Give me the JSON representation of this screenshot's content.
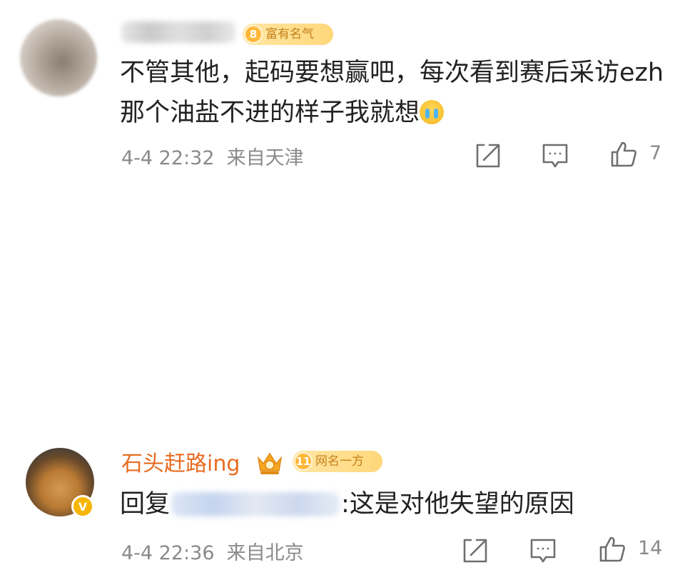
{
  "comments": [
    {
      "avatar": "blurred-avatar",
      "badge": {
        "level": "8",
        "label": "富有名气"
      },
      "content": "不管其他，起码要想赢吧，每次看到赛后采访ezh那个油盐不进的样子我就想",
      "emoji": "crying-face-emoji",
      "timestamp": "4-4 22:32",
      "location": "来自天津",
      "likes": "7"
    },
    {
      "avatar": "shiba-dog-avatar",
      "username": "石头赶路ing",
      "verified_mark": "V",
      "badge": {
        "level": "11",
        "label": "网名一方"
      },
      "reply_prefix": "回复",
      "content": ":这是对他失望的原因",
      "timestamp": "4-4 22:36",
      "location": "来自北京",
      "likes": "14"
    }
  ],
  "colors": {
    "username": "#e86b1f",
    "badge_text": "#c5801a",
    "badge_bg": "#ffd77a",
    "meta_text": "#8a8a8a",
    "content_text": "#222222"
  }
}
